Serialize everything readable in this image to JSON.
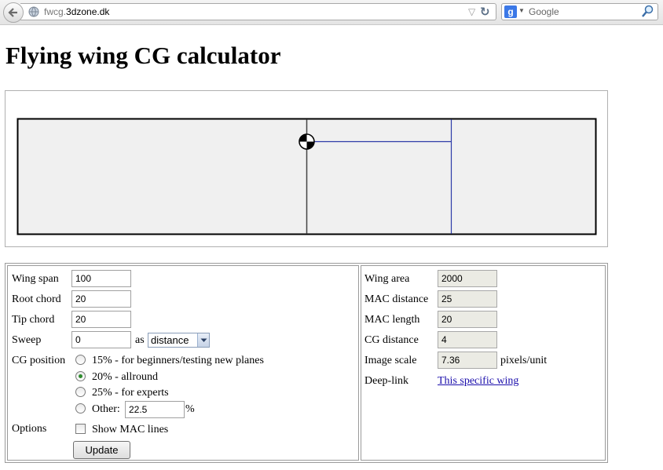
{
  "browser": {
    "url_dim": "fwcg.",
    "url_host": "3dzone.dk",
    "search_placeholder": "Google",
    "search_logo": "g"
  },
  "page": {
    "title": "Flying wing CG calculator"
  },
  "form": {
    "wing_span": {
      "label": "Wing span",
      "value": "100"
    },
    "root_chord": {
      "label": "Root chord",
      "value": "20"
    },
    "tip_chord": {
      "label": "Tip chord",
      "value": "20"
    },
    "sweep": {
      "label": "Sweep",
      "value": "0",
      "as_label": "as",
      "mode": "distance"
    },
    "cg_position": {
      "label": "CG position",
      "options": [
        "15% - for beginners/testing new planes",
        "20% - allround",
        "25% - for experts",
        "Other:"
      ],
      "selected_index": 1,
      "other_value": "22.5",
      "percent_symbol": "%"
    },
    "options": {
      "label": "Options",
      "show_mac_lines": "Show MAC lines",
      "show_mac_checked": false
    },
    "update_button": "Update"
  },
  "results": {
    "wing_area": {
      "label": "Wing area",
      "value": "2000"
    },
    "mac_distance": {
      "label": "MAC distance",
      "value": "25"
    },
    "mac_length": {
      "label": "MAC length",
      "value": "20"
    },
    "cg_distance": {
      "label": "CG distance",
      "value": "4"
    },
    "image_scale": {
      "label": "Image scale",
      "value": "7.36",
      "unit": "pixels/unit"
    },
    "deep_link": {
      "label": "Deep-link",
      "link_text": "This specific wing"
    }
  },
  "colors": {
    "wing_fill": "#f0f0f0",
    "mac_line": "#2d3ba8",
    "outline": "#000000"
  }
}
